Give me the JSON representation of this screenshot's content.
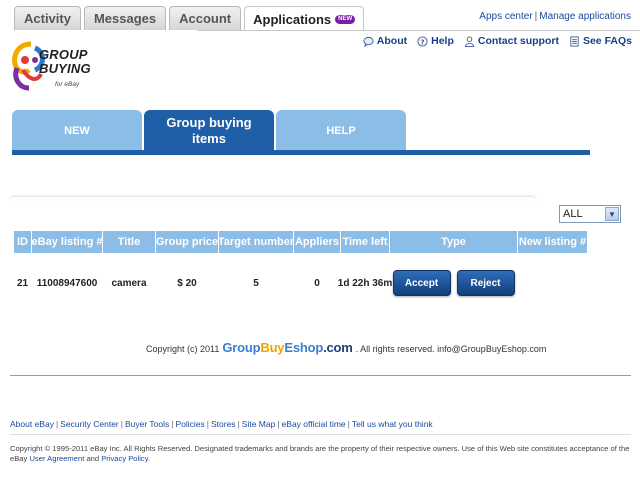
{
  "top_tabs": [
    {
      "label": "Activity"
    },
    {
      "label": "Messages"
    },
    {
      "label": "Account"
    },
    {
      "label": "Applications",
      "badge": "NEW"
    }
  ],
  "apps_links": {
    "apps_center": "Apps center",
    "separator": "|",
    "manage": "Manage applications"
  },
  "logo": {
    "line1": "GROUP",
    "line2": "BUYING",
    "sub": "for eBay"
  },
  "help_links": [
    {
      "label": "About",
      "icon": "speech-bubble-icon"
    },
    {
      "label": "Help",
      "icon": "question-icon"
    },
    {
      "label": "Contact support",
      "icon": "person-icon"
    },
    {
      "label": "See FAQs",
      "icon": "document-icon"
    }
  ],
  "nav_tabs": [
    {
      "label": "NEW"
    },
    {
      "label": "Group buying items",
      "active": true
    },
    {
      "label": "HELP"
    }
  ],
  "filter": {
    "selected": "ALL"
  },
  "table": {
    "columns": [
      "ID",
      "eBay listing #",
      "Title",
      "Group price",
      "Target number",
      "Appliers",
      "Time left",
      "Type",
      "New listing #"
    ],
    "rows": [
      {
        "id": "21",
        "listing": "11008947600",
        "title": "camera",
        "price": "$ 20",
        "target": "5",
        "appliers": "0",
        "time_left": "1d 22h 36m",
        "accept": "Accept",
        "reject": "Reject",
        "new_listing": ""
      }
    ]
  },
  "inner_copyright": {
    "prefix": "Copyright (c) 2011",
    "brand_1": "Group",
    "brand_2": "Buy",
    "brand_3": "Eshop",
    "brand_4": ".com",
    "suffix": ". All rights reserved. info@GroupBuyEshop.com"
  },
  "footer_links": [
    "About eBay",
    "Security Center",
    "Buyer Tools",
    "Policies",
    "Stores",
    "Site Map",
    "eBay official time",
    "Tell us what you think"
  ],
  "footer": {
    "text1": "Copyright © 1995-2011 eBay Inc. All Rights Reserved. Designated trademarks and brands are the property of their respective owners. Use of this Web site constitutes acceptance of the eBay",
    "link1": "User Agreement",
    "and": "and",
    "link2": "Privacy Policy",
    "end": "."
  },
  "colors": {
    "nav_active": "#1e5fa8",
    "nav_light": "#8cbde6",
    "link": "#1a4a9c",
    "badge": "#7a1fa2"
  }
}
